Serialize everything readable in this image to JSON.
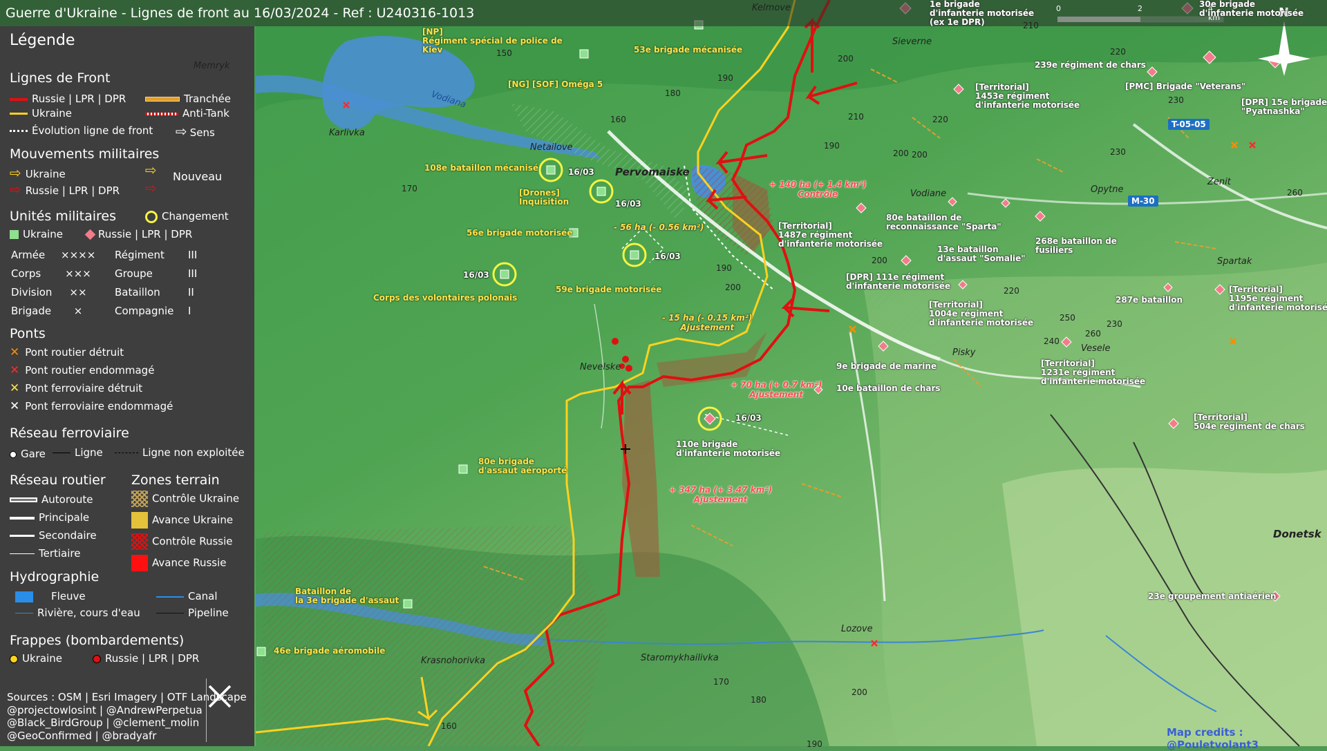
{
  "title": "Guerre d'Ukraine - Lignes de front au 16/03/2024 - Ref : U240316-1013",
  "legend": {
    "heading": "Légende",
    "front_lines": {
      "title": "Lignes de Front",
      "russia": "Russie | LPR | DPR",
      "ukraine": "Ukraine",
      "trench": "Tranchée",
      "antitank": "Anti-Tank",
      "evolution": "Évolution ligne de front",
      "direction": "Sens"
    },
    "movements": {
      "title": "Mouvements militaires",
      "ukraine": "Ukraine",
      "russia": "Russie | LPR | DPR",
      "new": "Nouveau"
    },
    "units": {
      "title": "Unités militaires",
      "change": "Changement",
      "ukraine": "Ukraine",
      "russia": "Russie | LPR | DPR",
      "rows": [
        {
          "a": "Armée",
          "a_sym": "××××",
          "b": "Régiment",
          "b_sym": "III"
        },
        {
          "a": "Corps",
          "a_sym": "×××",
          "b": "Groupe",
          "b_sym": "III"
        },
        {
          "a": "Division",
          "a_sym": "××",
          "b": "Bataillon",
          "b_sym": "II"
        },
        {
          "a": "Brigade",
          "a_sym": "×",
          "b": "Compagnie",
          "b_sym": "I"
        }
      ]
    },
    "bridges": {
      "title": "Ponts",
      "items": [
        "Pont routier détruit",
        "Pont routier endommagé",
        "Pont ferroviaire détruit",
        "Pont ferroviaire endommagé"
      ],
      "colors": [
        "#ff8c00",
        "#ff2a2a",
        "#ffe14a",
        "#ffffff"
      ]
    },
    "rail": {
      "title": "Réseau ferroviaire",
      "station": "Gare",
      "line": "Ligne",
      "unused": "Ligne non exploitée"
    },
    "roads": {
      "title": "Réseau routier",
      "items": [
        "Autoroute",
        "Principale",
        "Secondaire",
        "Tertiaire"
      ]
    },
    "terrain": {
      "title": "Zones terrain",
      "items": [
        "Contrôle Ukraine",
        "Avance Ukraine",
        "Contrôle Russie",
        "Avance Russie"
      ]
    },
    "hydro": {
      "title": "Hydrographie",
      "river": "Fleuve",
      "stream": "Rivière, cours d'eau",
      "canal": "Canal",
      "pipeline": "Pipeline"
    },
    "strikes": {
      "title": "Frappes (bombardements)",
      "ukraine": "Ukraine",
      "russia": "Russie | LPR | DPR"
    },
    "sources": [
      "Sources : OSM | Esri Imagery | OTF Landscape",
      "@projectowlosint | @AndrewPerpetua",
      "@Black_BirdGroup | @clement_molin",
      "@GeoConfirmed | @bradyafr"
    ]
  },
  "colors": {
    "russia": "#e01010",
    "ukraine": "#ffd21e",
    "panel": "#3e3e3e",
    "water": "#4a8fd1",
    "terrain_green": "#4f9a55"
  },
  "scale": {
    "zero": "0",
    "two": "2",
    "four": "4 km"
  },
  "compass": "N",
  "credits": "Map credits : @Pouletvolant3",
  "ua_units": [
    {
      "text": "[NP]\nRégiment spécial de police de\nKiev"
    },
    {
      "text": "53e brigade mécanisée"
    },
    {
      "text": "[NG] [SOF] Oméga 5"
    },
    {
      "text": "108e bataillon mécanisé"
    },
    {
      "text": "[Drones]\nInquisition"
    },
    {
      "text": "56e brigade motorisée"
    },
    {
      "text": "Corps des volontaires polonais"
    },
    {
      "text": "59e brigade motorisée"
    },
    {
      "text": "80e brigade\nd'assaut aéroporté"
    },
    {
      "text": "Bataillon de\nla 3e brigade d'assaut"
    },
    {
      "text": "46e brigade aéromobile"
    }
  ],
  "ru_units": [
    {
      "text": "1e brigade\nd'infanterie motorisée\n(ex 1e DPR)"
    },
    {
      "text": "30e brigade\nd'infanterie motorisée"
    },
    {
      "text": "239e régiment de chars"
    },
    {
      "text": "[PMC] Brigade \"Veterans\""
    },
    {
      "text": "[Territorial]\n1453e régiment\nd'infanterie motorisée"
    },
    {
      "text": "[DPR] 15e brigade\n\"Pyatnashka\""
    },
    {
      "text": "[Territorial]\n1487e régiment\nd'infanterie motorisée"
    },
    {
      "text": "80e bataillon de\nreconnaissance \"Sparta\""
    },
    {
      "text": "268e bataillon de\nfusiliers"
    },
    {
      "text": "13e bataillon\nd'assaut \"Somalie\""
    },
    {
      "text": "[DPR] 111e régiment\nd'infanterie motorisée"
    },
    {
      "text": "[Territorial]\n1004e régiment\nd'infanterie motorisée"
    },
    {
      "text": "287e bataillon"
    },
    {
      "text": "[Territorial]\n1195e régiment\nd'infanterie motorisée"
    },
    {
      "text": "9e brigade de marine"
    },
    {
      "text": "10e bataillon de chars"
    },
    {
      "text": "[Territorial]\n1231e régiment\nd'infanterie motorisée"
    },
    {
      "text": "[Territorial]\n504e régiment de chars"
    },
    {
      "text": "110e brigade\nd'infanterie motorisée"
    },
    {
      "text": "23e groupement antiaérien"
    }
  ],
  "changes": [
    {
      "text": "+ 140 ha (+ 1.4 km²)\nContrôle",
      "color": "red"
    },
    {
      "text": "- 56 ha (- 0.56 km²)",
      "color": "yellow"
    },
    {
      "text": "- 15 ha (- 0.15 km²)\nAjustement",
      "color": "yellow"
    },
    {
      "text": "+ 70 ha (+ 0.7 km²)\nAjustement",
      "color": "red"
    },
    {
      "text": "+ 347 ha (+ 3.47 km²)\nAjustement",
      "color": "red"
    }
  ],
  "dates": [
    "16/03",
    "16/03",
    "16/03",
    "16/03",
    "16/03"
  ],
  "towns": [
    "Kelmove",
    "Sieverne",
    "Vodiana",
    "Karlivka",
    "Netailove",
    "Pervomaiske",
    "Vodiane",
    "Opytne",
    "Zenit",
    "Spartak",
    "Nevelske",
    "Pisky",
    "Vesele",
    "Donetsk",
    "Lozove",
    "Krasnohorivka",
    "Staromykhailivka",
    "Memryk"
  ],
  "roads": [
    "T-05-05",
    "M-30"
  ],
  "elevations": [
    "210",
    "220",
    "230",
    "200",
    "190",
    "180",
    "170",
    "160",
    "150",
    "210",
    "220",
    "190",
    "200",
    "230",
    "260",
    "190",
    "200",
    "200",
    "220",
    "250",
    "260",
    "240",
    "230",
    "170",
    "180",
    "160",
    "200",
    "190",
    "200"
  ]
}
